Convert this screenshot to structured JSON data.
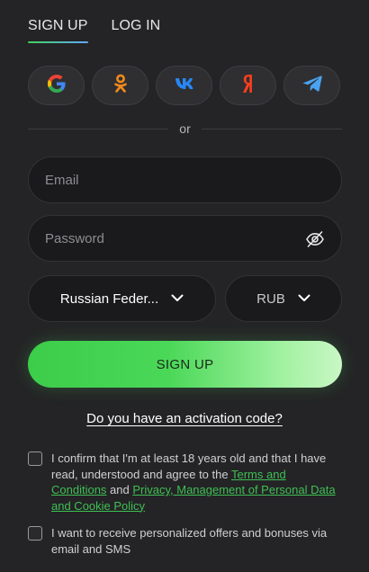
{
  "tabs": [
    {
      "label": "SIGN UP",
      "active": true
    },
    {
      "label": "LOG IN",
      "active": false
    }
  ],
  "social_buttons": [
    {
      "name": "google-icon"
    },
    {
      "name": "odnoklassniki-icon"
    },
    {
      "name": "vk-icon"
    },
    {
      "name": "yandex-icon"
    },
    {
      "name": "telegram-icon"
    }
  ],
  "divider_text": "or",
  "email": {
    "placeholder": "Email",
    "value": ""
  },
  "password": {
    "placeholder": "Password",
    "value": ""
  },
  "country": {
    "value": "Russian Feder..."
  },
  "currency": {
    "value": "RUB"
  },
  "signup_button": "SIGN UP",
  "activation_link": "Do you have an activation code?",
  "consent": {
    "part1": "I confirm that I'm at least 18 years old and that I have read, understood and agree to the ",
    "terms_link": "Terms and Conditions",
    "and": " and ",
    "privacy_link": "Privacy, Management of Personal Data and Cookie Policy",
    "checked": false
  },
  "offers": {
    "text": "I want to receive personalized offers and bonuses via email and SMS",
    "checked": false
  },
  "colors": {
    "background": "#242426",
    "accent_green": "#3fbf54",
    "tab_underline_start": "#3fd35a",
    "tab_underline_end": "#63a6ff"
  }
}
